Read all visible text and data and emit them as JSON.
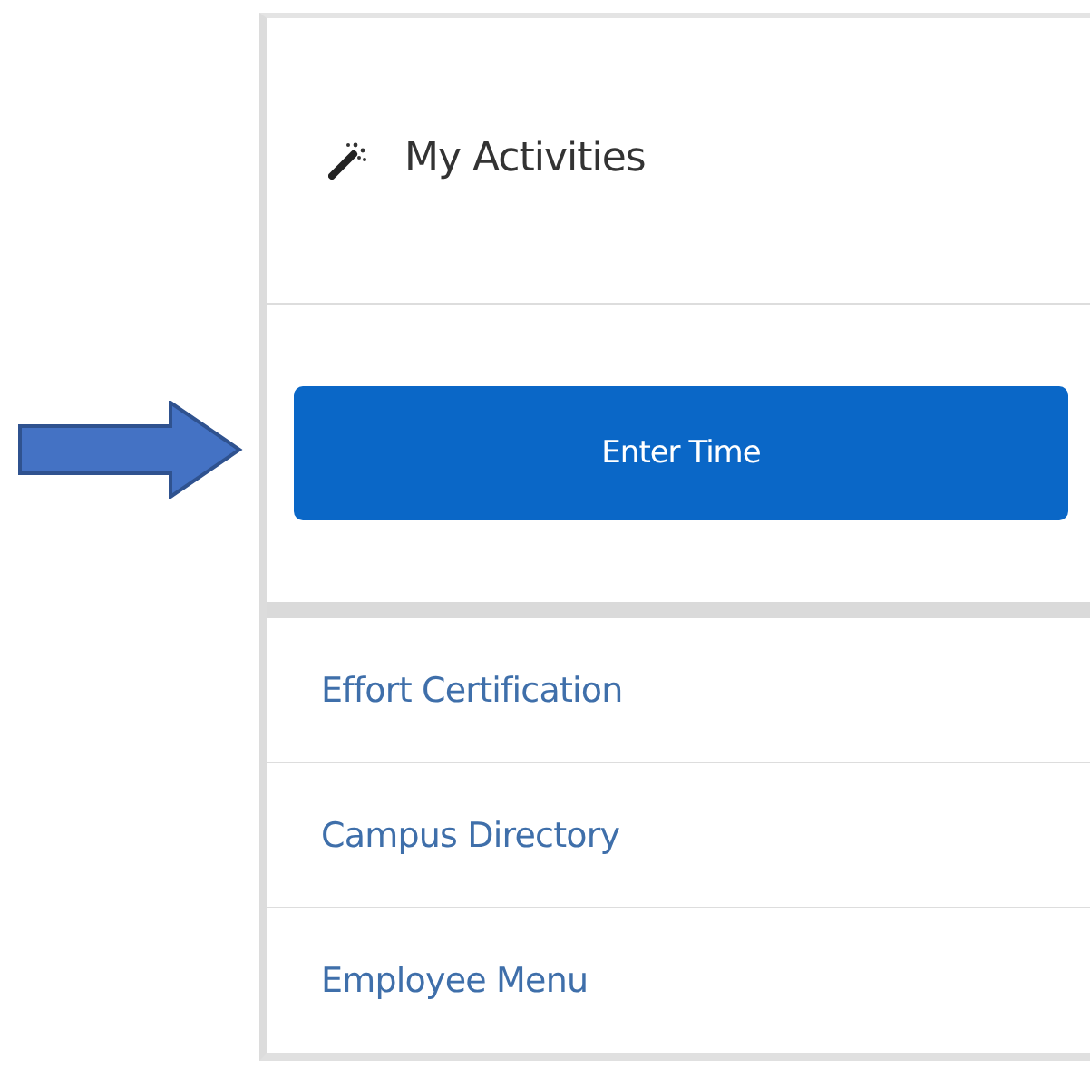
{
  "panel": {
    "title": "My Activities"
  },
  "primary_button": {
    "label": "Enter Time"
  },
  "links": [
    {
      "label": "Effort Certification"
    },
    {
      "label": "Campus Directory"
    },
    {
      "label": "Employee Menu"
    }
  ]
}
